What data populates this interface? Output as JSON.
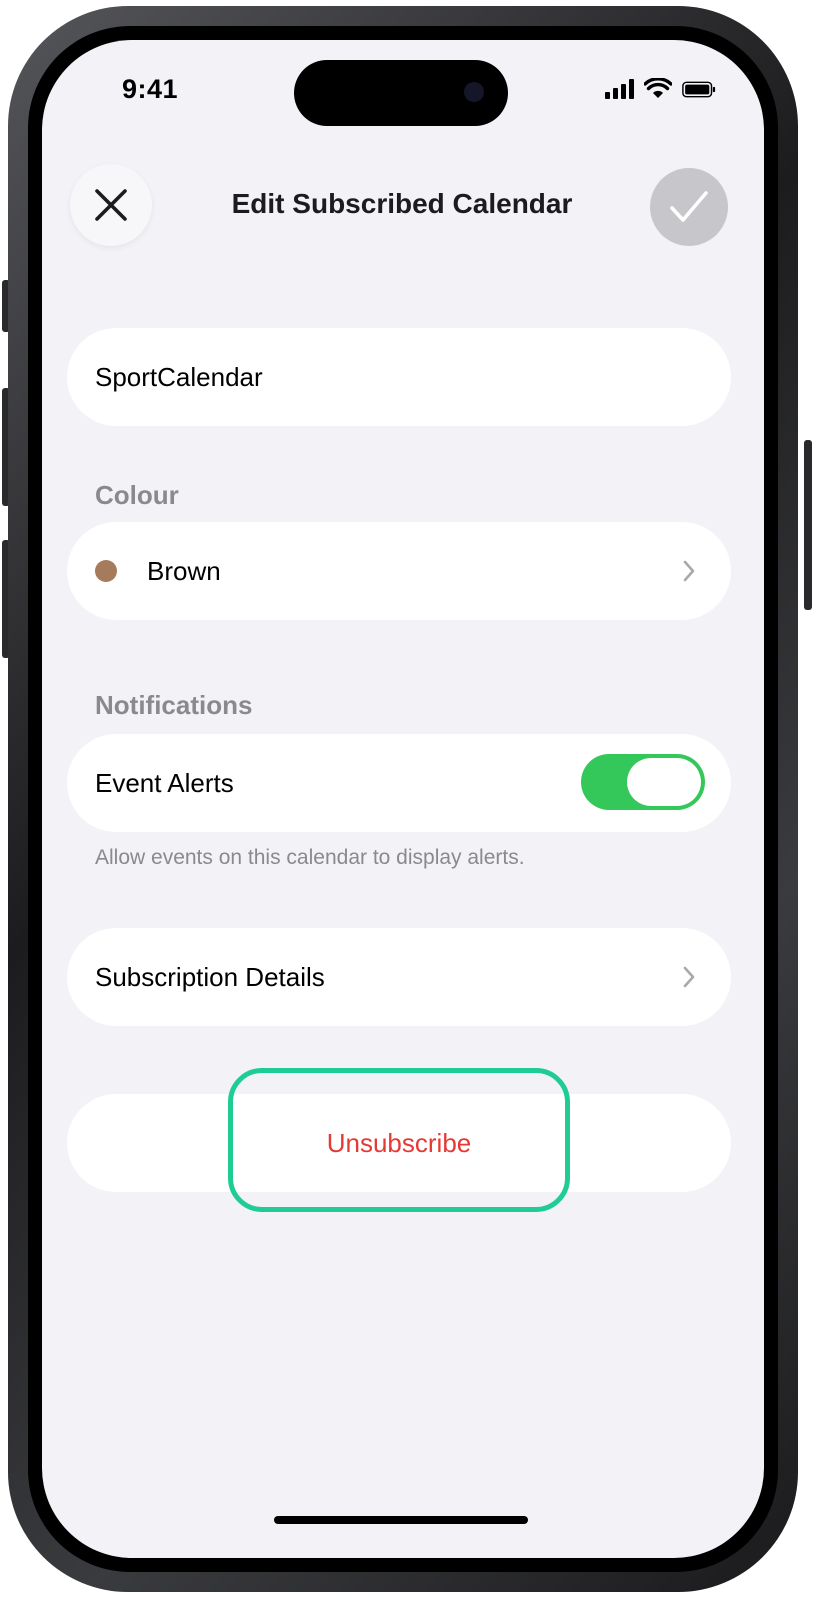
{
  "status_bar": {
    "time": "9:41",
    "icons": [
      "signal-icon",
      "wifi-icon",
      "battery-icon"
    ]
  },
  "header": {
    "title": "Edit Subscribed Calendar",
    "close_icon": "close-icon",
    "confirm_icon": "checkmark-icon"
  },
  "calendar_name": {
    "value": "SportCalendar"
  },
  "colour_section": {
    "label": "Colour",
    "selected": "Brown",
    "swatch_color": "#a67b5b"
  },
  "notifications_section": {
    "label": "Notifications",
    "event_alerts_label": "Event Alerts",
    "event_alerts_enabled": true,
    "footnote": "Allow events on this calendar to display alerts."
  },
  "subscription_details": {
    "label": "Subscription Details"
  },
  "unsubscribe": {
    "label": "Unsubscribe",
    "color": "#e53935"
  },
  "colors": {
    "background": "#f2f2f7",
    "toggle_on": "#34c759",
    "highlight": "#1ecc94"
  }
}
